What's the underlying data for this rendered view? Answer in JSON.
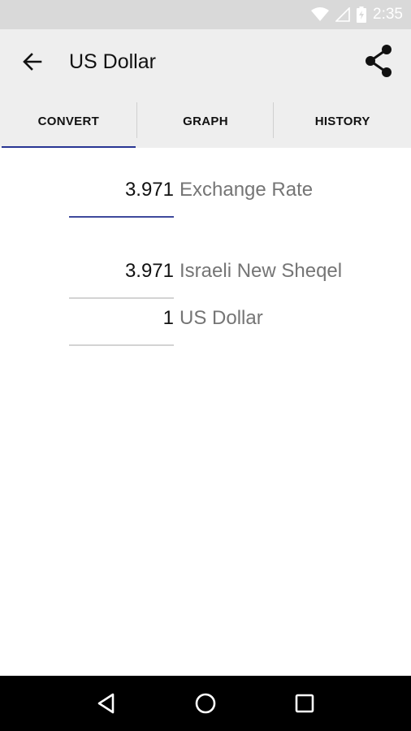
{
  "status_bar": {
    "time": "2:35",
    "icons": [
      "wifi-icon",
      "signal-icon",
      "battery-charging-icon"
    ]
  },
  "app_bar": {
    "title": "US Dollar",
    "back_icon": "arrow-back-icon",
    "share_icon": "share-icon"
  },
  "tabs": [
    {
      "label": "CONVERT",
      "selected": true
    },
    {
      "label": "GRAPH",
      "selected": false
    },
    {
      "label": "HISTORY",
      "selected": false
    }
  ],
  "converter": {
    "exchange_rate": {
      "value": "3.971",
      "label": "Exchange Rate"
    },
    "target": {
      "value": "3.971",
      "label": "Israeli New Sheqel"
    },
    "source": {
      "value": "1",
      "label": "US Dollar"
    }
  },
  "nav_bar": {
    "icons": [
      "back-triangle-icon",
      "home-circle-icon",
      "recents-square-icon"
    ]
  },
  "colors": {
    "accent": "#283593",
    "app_bar": "#eeeeee",
    "status_bar": "#d9d9d9",
    "label_gray": "#757575"
  }
}
